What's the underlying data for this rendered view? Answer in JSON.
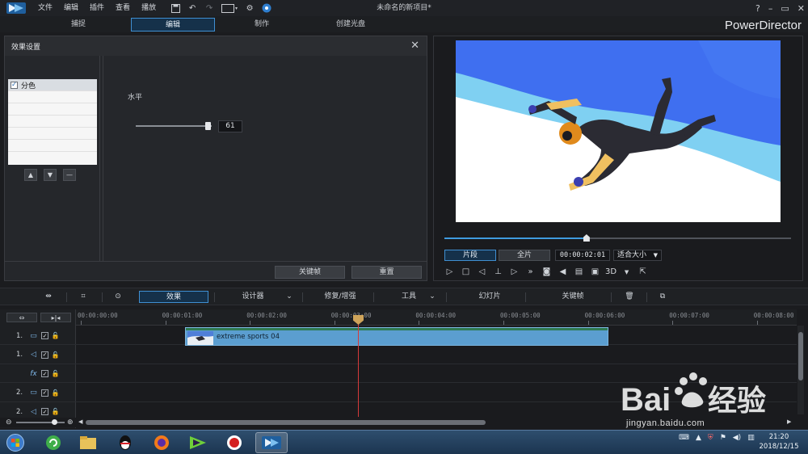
{
  "menubar": {
    "items": [
      "文件",
      "编辑",
      "插件",
      "查看",
      "播放"
    ],
    "window_title": "未命名的新项目*",
    "help": "?"
  },
  "modes": {
    "tabs": [
      "捕捉",
      "编辑",
      "制作",
      "创建光盘"
    ],
    "active": "编辑",
    "brand": "PowerDirector"
  },
  "effect_panel": {
    "title": "效果设置",
    "effects": [
      {
        "label": "分色",
        "checked": true
      }
    ],
    "param_label": "水平",
    "param_value": "61",
    "param_fraction": 0.95,
    "keyframe_button": "关键帧",
    "reset_button": "重置"
  },
  "preview": {
    "clip_mode": "片段",
    "full_mode": "全片",
    "timecode": "00:00:02:01",
    "fit_option": "适合大小",
    "three_d": "3D",
    "scrub_fraction": 0.41
  },
  "toolbar": {
    "effect": "效果",
    "designer": "设计器",
    "fix_enhance": "修复/增强",
    "tools": "工具",
    "slideshow": "幻灯片",
    "keyframe": "关键帧"
  },
  "timeline": {
    "ruler_labels": [
      "00:00:00:00",
      "00:00:01:00",
      "00:00:02:00",
      "00:00:03:00",
      "00:00:04:00",
      "00:00:05:00",
      "00:00:06:00",
      "00:00:07:00",
      "00:00:08:00"
    ],
    "tracks": [
      {
        "num": "1.",
        "icon": "video-track-icon"
      },
      {
        "num": "1.",
        "icon": "audio-track-icon"
      },
      {
        "num": "",
        "icon": "fx-track-icon",
        "fx": "fx"
      },
      {
        "num": "2.",
        "icon": "video-track-icon"
      },
      {
        "num": "2.",
        "icon": "audio-track-icon"
      }
    ],
    "clip_name": "extreme sports 04"
  },
  "taskbar": {
    "time": "21:20",
    "date": "2018/12/15"
  },
  "watermark": {
    "site": "jingyan.baidu.com"
  }
}
